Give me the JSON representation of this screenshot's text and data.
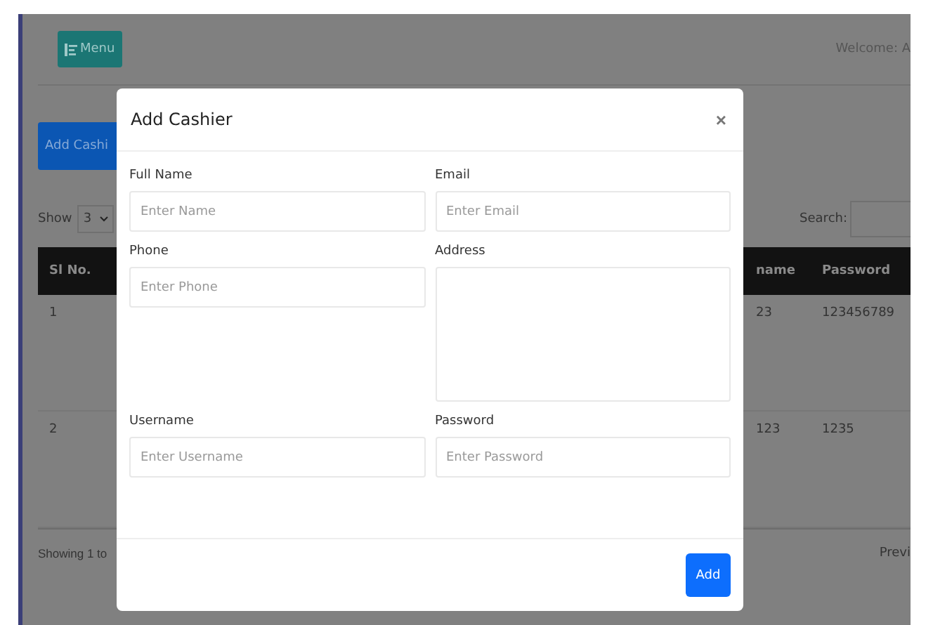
{
  "page": {
    "menu_button": "Menu",
    "welcome": "Welcome: A",
    "add_button": "Add Cashi",
    "show_label": "Show",
    "page_size": "3",
    "search_label": "Search:",
    "table": {
      "columns": [
        "Sl No.",
        "name",
        "Password"
      ],
      "rows": [
        [
          "1",
          "23",
          "123456789"
        ],
        [
          "2",
          "123",
          "1235"
        ]
      ]
    },
    "info": "Showing 1 to",
    "pager": "Previ"
  },
  "modal": {
    "title": "Add Cashier",
    "close": "×",
    "fields": [
      {
        "label": "Full Name",
        "placeholder": "Enter Name",
        "kind": "input"
      },
      {
        "label": "Email",
        "placeholder": "Enter Email",
        "kind": "input"
      },
      {
        "label": "Phone",
        "placeholder": "Enter Phone",
        "kind": "input"
      },
      {
        "label": "Address",
        "kind": "textarea"
      },
      {
        "label": "Username",
        "placeholder": "Enter Username",
        "kind": "input"
      },
      {
        "label": "Password",
        "placeholder": "Enter Password",
        "kind": "input"
      }
    ],
    "submit": "Add"
  }
}
